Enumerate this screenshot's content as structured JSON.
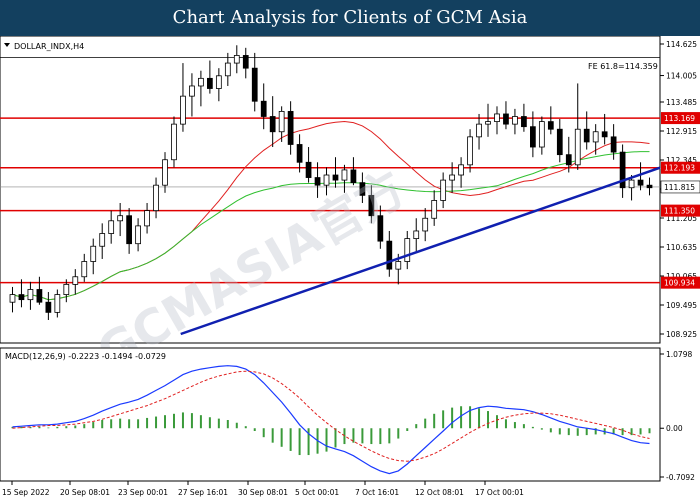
{
  "banner": {
    "title": "Chart Analysis for Clients of GCM Asia"
  },
  "watermark": "GCMASIA官方",
  "chart_data": [
    {
      "type": "candlestick",
      "symbol_label": "DOLLAR_INDX,H4",
      "y_ticks": [
        "114.625",
        "114.005",
        "113.485",
        "112.915",
        "112.345",
        "111.775",
        "111.205",
        "110.635",
        "110.065",
        "109.495",
        "108.925"
      ],
      "ylim": [
        108.925,
        114.625
      ],
      "x_ticks": [
        "15 Sep 2022",
        "20 Sep 08:01",
        "23 Sep 00:01",
        "27 Sep 16:01",
        "30 Sep 08:01",
        "5 Oct 00:01",
        "7 Oct 16:01",
        "12 Oct 08:01",
        "17 Oct 00:01"
      ],
      "fib_label": "FE 61.8=114.359",
      "fib_level": 114.359,
      "horizontal_levels": [
        {
          "label": "113.169",
          "value": 113.169
        },
        {
          "label": "112.193",
          "value": 112.193
        },
        {
          "label": "111.350",
          "value": 111.35
        },
        {
          "label": "109.934",
          "value": 109.934
        }
      ],
      "current_price_label": "111.815",
      "current_price": 111.815,
      "trendline": {
        "from": [
          "20 Sep 2022",
          108.925
        ],
        "to": [
          "19 Oct 2022",
          112.193
        ]
      },
      "colors": {
        "levels": "#e00000",
        "trendline": "#1020b0",
        "ma_fast": "#e02020",
        "ma_slow": "#30c030",
        "candles": "#000000"
      },
      "series": [
        {
          "type": "ohlc",
          "values": [
            [
              109.55,
              109.85,
              109.35,
              109.7
            ],
            [
              109.7,
              110.0,
              109.45,
              109.6
            ],
            [
              109.6,
              109.95,
              109.4,
              109.8
            ],
            [
              109.8,
              110.05,
              109.5,
              109.55
            ],
            [
              109.55,
              109.75,
              109.2,
              109.35
            ],
            [
              109.35,
              109.8,
              109.25,
              109.7
            ],
            [
              109.7,
              110.0,
              109.55,
              109.9
            ],
            [
              109.9,
              110.2,
              109.7,
              110.05
            ],
            [
              110.05,
              110.5,
              109.95,
              110.35
            ],
            [
              110.35,
              110.8,
              110.1,
              110.65
            ],
            [
              110.65,
              111.1,
              110.4,
              110.9
            ],
            [
              110.9,
              111.35,
              110.7,
              111.15
            ],
            [
              111.15,
              111.5,
              110.85,
              111.25
            ],
            [
              111.25,
              111.4,
              110.5,
              110.7
            ],
            [
              110.7,
              111.2,
              110.55,
              111.05
            ],
            [
              111.05,
              111.5,
              110.9,
              111.35
            ],
            [
              111.35,
              112.0,
              111.2,
              111.85
            ],
            [
              111.85,
              112.5,
              111.7,
              112.35
            ],
            [
              112.35,
              113.2,
              112.2,
              113.05
            ],
            [
              113.05,
              114.25,
              112.9,
              113.6
            ],
            [
              113.6,
              114.05,
              113.2,
              113.8
            ],
            [
              113.8,
              114.1,
              113.4,
              113.95
            ],
            [
              113.95,
              114.3,
              113.65,
              113.75
            ],
            [
              113.75,
              114.15,
              113.5,
              114.0
            ],
            [
              114.0,
              114.45,
              113.8,
              114.25
            ],
            [
              114.25,
              114.6,
              114.05,
              114.4
            ],
            [
              114.4,
              114.55,
              113.95,
              114.15
            ],
            [
              114.15,
              114.45,
              113.3,
              113.5
            ],
            [
              113.5,
              113.85,
              112.95,
              113.2
            ],
            [
              113.2,
              113.6,
              112.6,
              112.9
            ],
            [
              112.9,
              113.4,
              112.7,
              113.3
            ],
            [
              113.3,
              113.5,
              112.45,
              112.65
            ],
            [
              112.65,
              112.85,
              112.1,
              112.3
            ],
            [
              112.3,
              112.6,
              111.9,
              112.0
            ],
            [
              112.0,
              112.3,
              111.6,
              111.85
            ],
            [
              111.85,
              112.2,
              111.65,
              112.05
            ],
            [
              112.05,
              112.4,
              111.8,
              111.95
            ],
            [
              111.95,
              112.25,
              111.7,
              112.15
            ],
            [
              112.15,
              112.4,
              111.85,
              111.9
            ],
            [
              111.9,
              112.1,
              111.5,
              111.65
            ],
            [
              111.65,
              111.85,
              111.1,
              111.25
            ],
            [
              111.25,
              111.45,
              110.6,
              110.75
            ],
            [
              110.75,
              110.95,
              110.05,
              110.2
            ],
            [
              110.2,
              110.5,
              109.9,
              110.35
            ],
            [
              110.35,
              110.95,
              110.2,
              110.8
            ],
            [
              110.8,
              111.2,
              110.55,
              110.95
            ],
            [
              110.95,
              111.4,
              110.75,
              111.2
            ],
            [
              111.2,
              111.75,
              111.05,
              111.55
            ],
            [
              111.55,
              112.1,
              111.4,
              111.95
            ],
            [
              111.95,
              112.3,
              111.7,
              112.05
            ],
            [
              112.05,
              112.4,
              111.8,
              112.25
            ],
            [
              112.25,
              112.95,
              112.1,
              112.8
            ],
            [
              112.8,
              113.25,
              112.55,
              113.05
            ],
            [
              113.05,
              113.45,
              112.8,
              113.1
            ],
            [
              113.1,
              113.4,
              112.85,
              113.25
            ],
            [
              113.25,
              113.5,
              112.95,
              113.05
            ],
            [
              113.05,
              113.35,
              112.85,
              113.2
            ],
            [
              113.2,
              113.45,
              112.9,
              113.0
            ],
            [
              113.0,
              113.3,
              112.4,
              112.6
            ],
            [
              112.6,
              113.2,
              112.45,
              113.1
            ],
            [
              113.1,
              113.4,
              112.85,
              112.95
            ],
            [
              112.95,
              113.15,
              112.3,
              112.45
            ],
            [
              112.45,
              112.8,
              112.1,
              112.25
            ],
            [
              112.25,
              113.85,
              112.15,
              112.95
            ],
            [
              112.95,
              113.3,
              112.55,
              112.7
            ],
            [
              112.7,
              113.05,
              112.45,
              112.9
            ],
            [
              112.9,
              113.25,
              112.65,
              112.8
            ],
            [
              112.8,
              113.05,
              112.35,
              112.5
            ],
            [
              112.5,
              112.65,
              111.6,
              111.8
            ],
            [
              111.8,
              112.05,
              111.55,
              111.95
            ],
            [
              111.95,
              112.3,
              111.75,
              111.85
            ],
            [
              111.85,
              112.0,
              111.65,
              111.8
            ]
          ]
        },
        {
          "name": "",
          "type": "ma",
          "period": 21
        },
        {
          "name": "",
          "type": "ma",
          "period": 55
        }
      ]
    },
    {
      "type": "macd",
      "label": "MACD(12,26,9) -0.2223 -0.1494 -0.0729",
      "y_ticks": [
        "1.0798",
        "0.00",
        "-0.7092"
      ],
      "ylim": [
        -0.7092,
        1.0798
      ],
      "colors": {
        "macd": "#1a3aff",
        "signal": "#e02020",
        "histogram": "#3a9a3a"
      },
      "macd": [
        0.02,
        0.03,
        0.04,
        0.05,
        0.05,
        0.06,
        0.08,
        0.1,
        0.14,
        0.19,
        0.25,
        0.3,
        0.35,
        0.38,
        0.42,
        0.48,
        0.55,
        0.62,
        0.7,
        0.78,
        0.83,
        0.86,
        0.88,
        0.9,
        0.91,
        0.9,
        0.86,
        0.78,
        0.66,
        0.52,
        0.38,
        0.22,
        0.05,
        -0.08,
        -0.18,
        -0.26,
        -0.3,
        -0.34,
        -0.4,
        -0.48,
        -0.56,
        -0.62,
        -0.66,
        -0.62,
        -0.52,
        -0.4,
        -0.28,
        -0.16,
        -0.04,
        0.08,
        0.18,
        0.26,
        0.3,
        0.32,
        0.31,
        0.29,
        0.28,
        0.27,
        0.24,
        0.2,
        0.15,
        0.1,
        0.06,
        0.02,
        0.0,
        -0.02,
        -0.05,
        -0.08,
        -0.13,
        -0.18,
        -0.21,
        -0.2223
      ],
      "signal": [
        0.0,
        0.01,
        0.02,
        0.03,
        0.04,
        0.04,
        0.05,
        0.06,
        0.08,
        0.1,
        0.13,
        0.17,
        0.21,
        0.25,
        0.29,
        0.33,
        0.38,
        0.43,
        0.49,
        0.55,
        0.61,
        0.67,
        0.72,
        0.76,
        0.79,
        0.82,
        0.83,
        0.82,
        0.79,
        0.73,
        0.65,
        0.55,
        0.44,
        0.31,
        0.19,
        0.08,
        -0.02,
        -0.11,
        -0.19,
        -0.26,
        -0.33,
        -0.39,
        -0.44,
        -0.47,
        -0.48,
        -0.46,
        -0.42,
        -0.37,
        -0.3,
        -0.22,
        -0.14,
        -0.06,
        0.01,
        0.07,
        0.12,
        0.16,
        0.19,
        0.21,
        0.22,
        0.22,
        0.21,
        0.19,
        0.16,
        0.13,
        0.1,
        0.07,
        0.04,
        0.01,
        -0.03,
        -0.08,
        -0.12,
        -0.1494
      ],
      "histogram": [
        0.02,
        0.02,
        0.02,
        0.02,
        0.01,
        0.02,
        0.03,
        0.04,
        0.06,
        0.09,
        0.12,
        0.13,
        0.14,
        0.13,
        0.13,
        0.15,
        0.17,
        0.19,
        0.21,
        0.23,
        0.22,
        0.19,
        0.16,
        0.14,
        0.12,
        0.08,
        0.03,
        -0.04,
        -0.13,
        -0.21,
        -0.27,
        -0.33,
        -0.39,
        -0.39,
        -0.37,
        -0.34,
        -0.28,
        -0.23,
        -0.21,
        -0.22,
        -0.23,
        -0.23,
        -0.22,
        -0.15,
        -0.04,
        0.06,
        0.14,
        0.21,
        0.26,
        0.3,
        0.32,
        0.32,
        0.29,
        0.25,
        0.19,
        0.13,
        0.09,
        0.06,
        0.02,
        -0.02,
        -0.06,
        -0.09,
        -0.1,
        -0.11,
        -0.1,
        -0.09,
        -0.09,
        -0.09,
        -0.1,
        -0.1,
        -0.09,
        -0.0729
      ]
    }
  ]
}
